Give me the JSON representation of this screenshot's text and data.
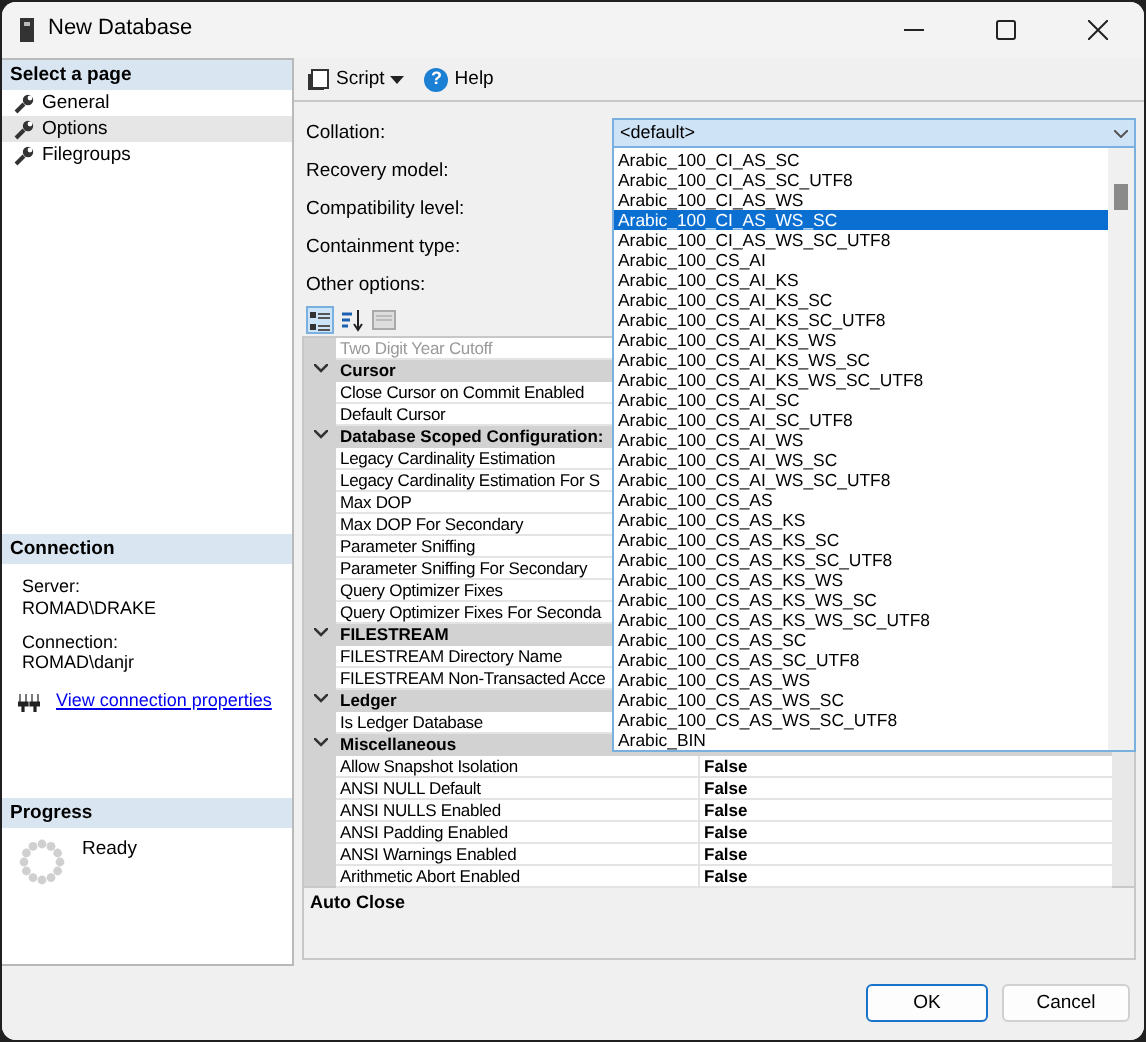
{
  "window": {
    "title": "New Database"
  },
  "sidebar": {
    "header": "Select a page",
    "pages": [
      {
        "label": "General",
        "selected": false
      },
      {
        "label": "Options",
        "selected": true
      },
      {
        "label": "Filegroups",
        "selected": false
      }
    ]
  },
  "connection": {
    "header": "Connection",
    "server_label": "Server:",
    "server": "ROMAD\\DRAKE",
    "connection_label": "Connection:",
    "connection": "ROMAD\\danjr",
    "link": "View connection properties"
  },
  "progress": {
    "header": "Progress",
    "status": "Ready"
  },
  "toolbar": {
    "script": "Script",
    "help": "Help",
    "help_glyph": "?"
  },
  "form": {
    "labels": [
      "Collation:",
      "Recovery model:",
      "Compatibility level:",
      "Containment type:"
    ],
    "other_options_label": "Other options:",
    "collation": {
      "value": "<default>",
      "expanded": true,
      "options": [
        {
          "label": "Arabic_100_CI_AS_SC",
          "selected": false
        },
        {
          "label": "Arabic_100_CI_AS_SC_UTF8",
          "selected": false
        },
        {
          "label": "Arabic_100_CI_AS_WS",
          "selected": false
        },
        {
          "label": "Arabic_100_CI_AS_WS_SC",
          "selected": true
        },
        {
          "label": "Arabic_100_CI_AS_WS_SC_UTF8",
          "selected": false
        },
        {
          "label": "Arabic_100_CS_AI",
          "selected": false
        },
        {
          "label": "Arabic_100_CS_AI_KS",
          "selected": false
        },
        {
          "label": "Arabic_100_CS_AI_KS_SC",
          "selected": false
        },
        {
          "label": "Arabic_100_CS_AI_KS_SC_UTF8",
          "selected": false
        },
        {
          "label": "Arabic_100_CS_AI_KS_WS",
          "selected": false
        },
        {
          "label": "Arabic_100_CS_AI_KS_WS_SC",
          "selected": false
        },
        {
          "label": "Arabic_100_CS_AI_KS_WS_SC_UTF8",
          "selected": false
        },
        {
          "label": "Arabic_100_CS_AI_SC",
          "selected": false
        },
        {
          "label": "Arabic_100_CS_AI_SC_UTF8",
          "selected": false
        },
        {
          "label": "Arabic_100_CS_AI_WS",
          "selected": false
        },
        {
          "label": "Arabic_100_CS_AI_WS_SC",
          "selected": false
        },
        {
          "label": "Arabic_100_CS_AI_WS_SC_UTF8",
          "selected": false
        },
        {
          "label": "Arabic_100_CS_AS",
          "selected": false
        },
        {
          "label": "Arabic_100_CS_AS_KS",
          "selected": false
        },
        {
          "label": "Arabic_100_CS_AS_KS_SC",
          "selected": false
        },
        {
          "label": "Arabic_100_CS_AS_KS_SC_UTF8",
          "selected": false
        },
        {
          "label": "Arabic_100_CS_AS_KS_WS",
          "selected": false
        },
        {
          "label": "Arabic_100_CS_AS_KS_WS_SC",
          "selected": false
        },
        {
          "label": "Arabic_100_CS_AS_KS_WS_SC_UTF8",
          "selected": false
        },
        {
          "label": "Arabic_100_CS_AS_SC",
          "selected": false
        },
        {
          "label": "Arabic_100_CS_AS_SC_UTF8",
          "selected": false
        },
        {
          "label": "Arabic_100_CS_AS_WS",
          "selected": false
        },
        {
          "label": "Arabic_100_CS_AS_WS_SC",
          "selected": false
        },
        {
          "label": "Arabic_100_CS_AS_WS_SC_UTF8",
          "selected": false
        },
        {
          "label": "Arabic_BIN",
          "selected": false
        }
      ]
    }
  },
  "grid": {
    "rows": [
      {
        "kind": "property",
        "name": "Two Digit Year Cutoff",
        "disabled": true
      },
      {
        "kind": "category",
        "name": "Cursor",
        "expanded": true
      },
      {
        "kind": "property",
        "name": "Close Cursor on Commit Enabled",
        "disabled": false
      },
      {
        "kind": "property",
        "name": "Default Cursor",
        "disabled": false
      },
      {
        "kind": "category",
        "name": "Database Scoped Configuration:",
        "expanded": true
      },
      {
        "kind": "property",
        "name": "Legacy Cardinality Estimation",
        "disabled": false
      },
      {
        "kind": "property",
        "name": "Legacy Cardinality Estimation For S",
        "disabled": false
      },
      {
        "kind": "property",
        "name": "Max DOP",
        "disabled": false
      },
      {
        "kind": "property",
        "name": "Max DOP For Secondary",
        "disabled": false
      },
      {
        "kind": "property",
        "name": "Parameter Sniffing",
        "disabled": false
      },
      {
        "kind": "property",
        "name": "Parameter Sniffing For Secondary",
        "disabled": false
      },
      {
        "kind": "property",
        "name": "Query Optimizer Fixes",
        "disabled": false
      },
      {
        "kind": "property",
        "name": "Query Optimizer Fixes For Seconda",
        "disabled": false
      },
      {
        "kind": "category",
        "name": "FILESTREAM",
        "expanded": true
      },
      {
        "kind": "property",
        "name": "FILESTREAM Directory Name",
        "disabled": false
      },
      {
        "kind": "property",
        "name": "FILESTREAM Non-Transacted Acce",
        "disabled": false
      },
      {
        "kind": "category",
        "name": "Ledger",
        "expanded": true
      },
      {
        "kind": "property",
        "name": "Is Ledger Database",
        "disabled": false
      },
      {
        "kind": "category",
        "name": "Miscellaneous",
        "expanded": true
      },
      {
        "kind": "property",
        "name": "Allow Snapshot Isolation",
        "value": "False",
        "disabled": false
      },
      {
        "kind": "property",
        "name": "ANSI NULL Default",
        "value": "False",
        "disabled": false
      },
      {
        "kind": "property",
        "name": "ANSI NULLS Enabled",
        "value": "False",
        "disabled": false
      },
      {
        "kind": "property",
        "name": "ANSI Padding Enabled",
        "value": "False",
        "disabled": false
      },
      {
        "kind": "property",
        "name": "ANSI Warnings Enabled",
        "value": "False",
        "disabled": false
      },
      {
        "kind": "property",
        "name": "Arithmetic Abort Enabled",
        "value": "False",
        "disabled": false
      }
    ]
  },
  "description": {
    "title": "Auto Close"
  },
  "buttons": [
    {
      "label": "OK",
      "kind": "default"
    },
    {
      "label": "Cancel",
      "kind": "normal"
    }
  ]
}
